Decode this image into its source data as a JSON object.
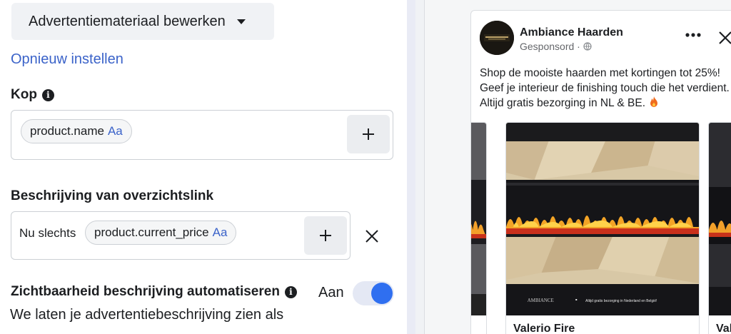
{
  "editor": {
    "edit_button_label": "Advertentiemateriaal bewerken",
    "reset_link": "Opnieuw instellen",
    "headline": {
      "label": "Kop",
      "token_text": "product.name",
      "token_suffix": "Aa"
    },
    "description": {
      "label": "Beschrijving van overzichtslink",
      "prefix": "Nu slechts",
      "token_text": "product.current_price",
      "token_suffix": "Aa"
    },
    "automate": {
      "label": "Zichtbaarheid beschrijving automatiseren",
      "toggle_state": "Aan",
      "toggle_on": true,
      "helper_text": "We laten je advertentiebeschrijving zien als"
    }
  },
  "preview": {
    "page_name": "Ambiance Haarden",
    "sponsored": "Gesponsord ·",
    "post_text": "Shop de mooiste haarden met kortingen tot 25%! Geef je interieur de finishing touch die het verdient. Altijd gratis bezorging in NL & BE.",
    "cards": [
      {
        "title": ""
      },
      {
        "title": "Valerio Fire",
        "banner_brand": "AMBIANCE",
        "banner_text": "Altijd gratis bezorging in Nederland en België!"
      },
      {
        "title": "Val"
      }
    ]
  }
}
